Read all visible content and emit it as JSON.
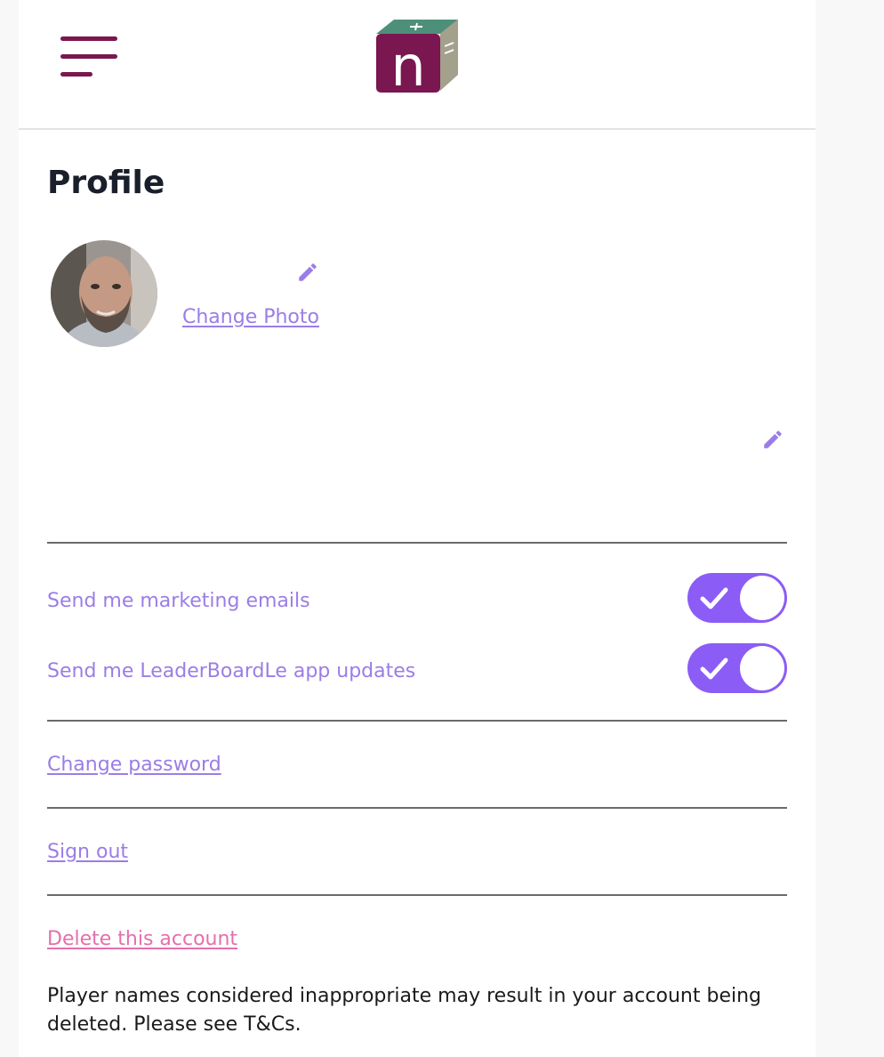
{
  "header": {
    "menu_icon": "hamburger-menu-icon",
    "logo_letter": "n",
    "logo_colors": {
      "front": "#7a1650",
      "top": "#4e8f7a",
      "side": "#a3a08c"
    }
  },
  "profile": {
    "title": "Profile",
    "change_photo_label": "Change Photo",
    "edit_icon": "pencil-icon"
  },
  "preferences": {
    "items": [
      {
        "label": "Send me marketing emails",
        "enabled": true
      },
      {
        "label": "Send me LeaderBoardLe app updates",
        "enabled": true
      }
    ]
  },
  "account": {
    "change_password_label": "Change password",
    "sign_out_label": "Sign out",
    "delete_label": "Delete this account"
  },
  "notice": "Player names considered inappropriate may result in your account being deleted. Please see T&Cs.",
  "colors": {
    "brand": "#7a1650",
    "accent": "#8b5cf6",
    "link": "#9b7de6",
    "danger_link": "#e56fac"
  }
}
